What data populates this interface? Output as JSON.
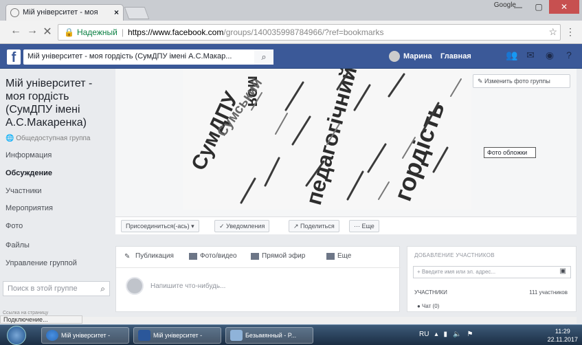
{
  "browser": {
    "tab_title": "Мій університет - моя",
    "user_badge": "Google",
    "security_label": "Надежный",
    "url_host": "https://www.facebook.com",
    "url_path": "/groups/1400359987849​66/?ref=bookmarks"
  },
  "fb": {
    "logo": "f",
    "search_value": "Мій університет - моя гордість (СумДПУ імені А.С.Макар...",
    "user_name": "Марина",
    "home_label": "Главная"
  },
  "group": {
    "name": "Мій університет - моя гордість (СумДПУ імені А.С.Макаренка)",
    "privacy": "Общедоступная группа",
    "nav": [
      "Информация",
      "Обсуждение",
      "Участники",
      "Мероприятия",
      "Фото",
      "Файлы",
      "Управление группой"
    ],
    "search_placeholder": "Поиск в этой группе"
  },
  "cover": {
    "change_button": "Изменить фото группы",
    "tooltip": "Фото обложки",
    "words": [
      "СумДПУ",
      "моя",
      "гордість",
      "педагогічний",
      "Сумський"
    ]
  },
  "actions": {
    "joined": "Присоединиться(-ась) ▾",
    "notifications": "✓ Уведомления",
    "share": "↗ Поделиться",
    "more": "··· Еще"
  },
  "composer": {
    "tabs": [
      "Публикация",
      "Фото/видео",
      "Прямой эфир",
      "Еще"
    ],
    "placeholder": "Напишите что-нибудь..."
  },
  "right_panel": {
    "header": "ДОБАВЛЕНИЕ УЧАСТНИКОВ",
    "input_placeholder": "+ Введите имя или эл. адрес...",
    "members_label": "УЧАСТНИКИ",
    "members_count": "111 участников",
    "chat": "● Чат (0)"
  },
  "status": {
    "text": "Подключение...",
    "hint": "Ссылка на страницу"
  },
  "taskbar": {
    "items": [
      "Мій університет -",
      "Мій університет -",
      "Безымянный - P..."
    ],
    "time": "11:29",
    "date": "22.11.2017"
  }
}
